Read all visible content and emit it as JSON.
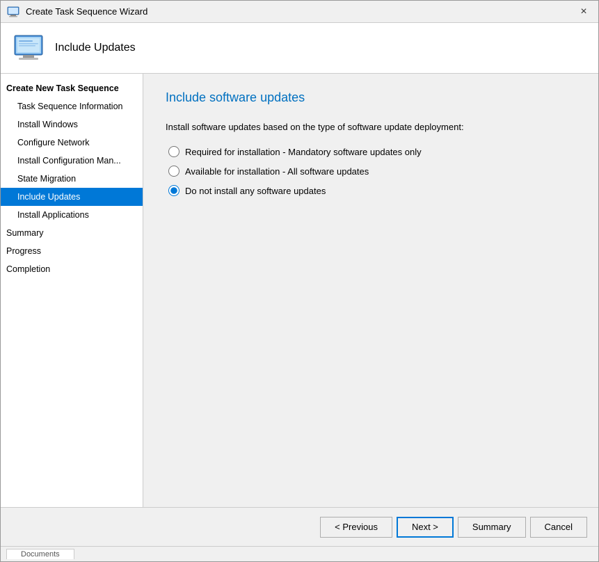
{
  "window": {
    "title": "Create Task Sequence Wizard",
    "close_label": "×"
  },
  "header": {
    "title": "Include Updates"
  },
  "sidebar": {
    "items": [
      {
        "id": "create-new",
        "label": "Create New Task Sequence",
        "level": "top-level",
        "active": false
      },
      {
        "id": "task-sequence-info",
        "label": "Task Sequence Information",
        "level": "sub-level",
        "active": false
      },
      {
        "id": "install-windows",
        "label": "Install Windows",
        "level": "sub-level",
        "active": false
      },
      {
        "id": "configure-network",
        "label": "Configure Network",
        "level": "sub-level",
        "active": false
      },
      {
        "id": "install-config-mgr",
        "label": "Install Configuration Man...",
        "level": "sub-level",
        "active": false
      },
      {
        "id": "state-migration",
        "label": "State Migration",
        "level": "sub-level",
        "active": false
      },
      {
        "id": "include-updates",
        "label": "Include Updates",
        "level": "sub-level",
        "active": true
      },
      {
        "id": "install-applications",
        "label": "Install Applications",
        "level": "sub-level",
        "active": false
      },
      {
        "id": "summary",
        "label": "Summary",
        "level": "section-header",
        "active": false
      },
      {
        "id": "progress",
        "label": "Progress",
        "level": "section-header",
        "active": false
      },
      {
        "id": "completion",
        "label": "Completion",
        "level": "section-header",
        "active": false
      }
    ]
  },
  "main": {
    "title": "Include software updates",
    "description": "Install software updates based on the type of software update deployment:",
    "options": [
      {
        "id": "required",
        "label": "Required for installation - Mandatory software updates only",
        "checked": false
      },
      {
        "id": "available",
        "label": "Available for installation - All software updates",
        "checked": false
      },
      {
        "id": "none",
        "label": "Do not install any software updates",
        "checked": true
      }
    ]
  },
  "footer": {
    "previous_label": "< Previous",
    "next_label": "Next >",
    "summary_label": "Summary",
    "cancel_label": "Cancel"
  },
  "bottom_bar": {
    "tab_label": "Documents"
  }
}
